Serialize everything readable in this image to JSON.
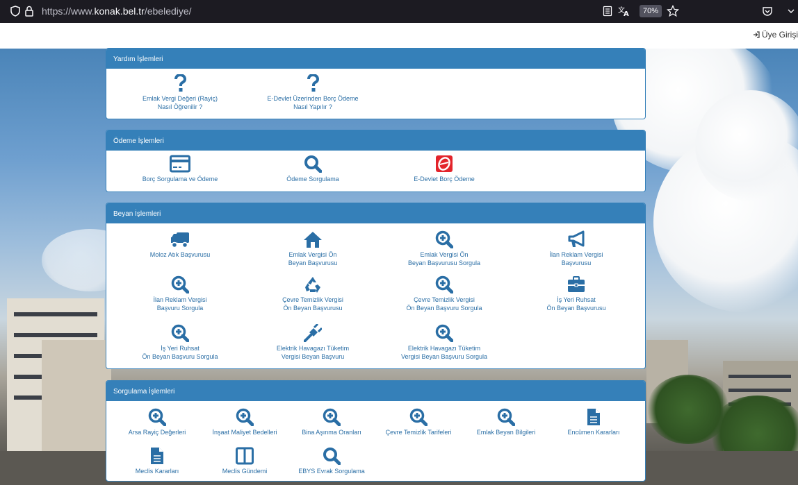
{
  "browser": {
    "url_prefix": "https://www.",
    "url_domain": "konak.bel.tr",
    "url_path": "/ebelediye/",
    "zoom": "70%"
  },
  "header": {
    "login_label": "Üye Girişi"
  },
  "panels": [
    {
      "title": "Yardım İşlemleri",
      "items": [
        {
          "label_line1": "Emlak Vergi Değeri (Rayiç)",
          "label_line2": "Nasıl Öğrenilir ?",
          "icon": "question-icon"
        },
        {
          "label_line1": "E-Devlet Üzerinden Borç Ödeme",
          "label_line2": "Nasıl Yapılır ?",
          "icon": "question-icon"
        }
      ]
    },
    {
      "title": "Ödeme İşlemleri",
      "items": [
        {
          "label_line1": "Borç Sorgulama ve Ödeme",
          "label_line2": "",
          "icon": "credit-card-icon"
        },
        {
          "label_line1": "Ödeme Sorgulama",
          "label_line2": "",
          "icon": "search-icon"
        },
        {
          "label_line1": "E-Devlet Borç Ödeme",
          "label_line2": "",
          "icon": "edevlet-logo-icon"
        }
      ]
    },
    {
      "title": "Beyan İşlemleri",
      "items": [
        {
          "label_line1": "Moloz Atık Başvurusu",
          "label_line2": "",
          "icon": "truck-icon"
        },
        {
          "label_line1": "Emlak Vergisi Ön",
          "label_line2": "Beyan Başvurusu",
          "icon": "home-icon"
        },
        {
          "label_line1": "Emlak Vergisi Ön",
          "label_line2": "Beyan Başvurusu Sorgula",
          "icon": "zoom-in-icon"
        },
        {
          "label_line1": "İlan Reklam Vergisi",
          "label_line2": "Başvurusu",
          "icon": "megaphone-icon"
        },
        {
          "label_line1": "İlan Reklam Vergisi",
          "label_line2": "Başvuru Sorgula",
          "icon": "zoom-in-icon"
        },
        {
          "label_line1": "Çevre Temizlik Vergisi",
          "label_line2": "Ön Beyan Başvurusu",
          "icon": "recycle-icon"
        },
        {
          "label_line1": "Çevre Temizlik Vergisi",
          "label_line2": "Ön Beyan Başvuru Sorgula",
          "icon": "zoom-in-icon"
        },
        {
          "label_line1": "İş Yeri Ruhsat",
          "label_line2": "Ön Beyan Başvurusu",
          "icon": "briefcase-icon"
        },
        {
          "label_line1": "İş Yeri Ruhsat",
          "label_line2": "Ön Beyan Başvuru Sorgula",
          "icon": "zoom-in-icon"
        },
        {
          "label_line1": "Elektrik Havagazı Tüketim",
          "label_line2": "Vergisi Beyan Başvuru",
          "icon": "plug-icon"
        },
        {
          "label_line1": "Elektrik Havagazı Tüketim",
          "label_line2": "Vergisi Beyan Başvuru Sorgula",
          "icon": "zoom-in-icon"
        }
      ]
    },
    {
      "title": "Sorgulama İşlemleri",
      "items": [
        {
          "label_line1": "Arsa Rayiç Değerleri",
          "label_line2": "",
          "icon": "zoom-in-icon"
        },
        {
          "label_line1": "İnşaat Maliyet Bedelleri",
          "label_line2": "",
          "icon": "zoom-in-icon"
        },
        {
          "label_line1": "Bina Aşınma Oranları",
          "label_line2": "",
          "icon": "zoom-in-icon"
        },
        {
          "label_line1": "Çevre Temizlik Tarifeleri",
          "label_line2": "",
          "icon": "zoom-in-icon"
        },
        {
          "label_line1": "Emlak Beyan Bilgileri",
          "label_line2": "",
          "icon": "zoom-in-icon"
        },
        {
          "label_line1": "Encümen Kararları",
          "label_line2": "",
          "icon": "document-icon"
        },
        {
          "label_line1": "Meclis Kararları",
          "label_line2": "",
          "icon": "document-icon"
        },
        {
          "label_line1": "Meclis Gündemi",
          "label_line2": "",
          "icon": "columns-icon"
        },
        {
          "label_line1": "EBYS Evrak Sorgulama",
          "label_line2": "",
          "icon": "search-icon"
        }
      ]
    }
  ],
  "colors": {
    "brand_blue": "#3580b9",
    "link_blue": "#2a6ea5",
    "browser_dark": "#1c1b22"
  }
}
